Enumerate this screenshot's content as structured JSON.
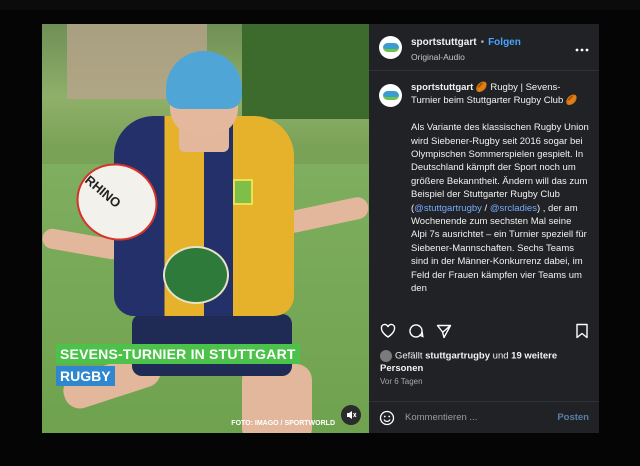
{
  "post": {
    "account": "sportstuttgart",
    "follow_label": "Folgen",
    "audio": "Original-Audio",
    "separator": "•",
    "caption_username": "sportstuttgart",
    "caption_title": "🏉 Rugby | Sevens-Turnier beim Stuttgarter Rugby Club 🏉",
    "caption_body_1": "Als Variante des klassischen Rugby Union wird Siebener-Rugby seit 2016 sogar bei Olympischen Sommerspielen gespielt. In Deutschland kämpft der Sport noch um größere Bekanntheit. Ändern will das zum Beispiel der Stuttgarter Rugby Club (",
    "mention_1": "@stuttgartrugby",
    "caption_body_2": " / ",
    "mention_2": "@srcladies",
    "caption_body_3": ") , der am Wochenende zum sechsten Mal seine Alpi 7s ausrichtet – ein Turnier speziell für Siebener-Mannschaften. Sechs Teams sind in der Männer-Konkurrenz dabei, im Feld der Frauen kämpfen vier Teams um den",
    "likes_prefix": "Gefällt ",
    "likes_user": "stuttgartrugby",
    "likes_mid": " und ",
    "likes_count": "19 weitere Personen",
    "date": "Vor 6 Tagen",
    "comment_placeholder": "Kommentieren ...",
    "post_button": "Posten"
  },
  "image": {
    "caption_line1": "SEVENS-TURNIER IN STUTTGART",
    "caption_line2": "RUGBY",
    "credit": "FOTO: IMAGO / SPORTWORLD",
    "ball_text": "RHINO"
  },
  "icons": {
    "more": "more-options-icon",
    "heart": "heart-icon",
    "comment": "comment-icon",
    "share": "share-icon",
    "bookmark": "bookmark-icon",
    "emoji": "emoji-icon",
    "mute": "mute-icon"
  },
  "colors": {
    "follow": "#4aa3ff",
    "mention": "#78a9ff",
    "caption_green": "#4cc24a",
    "caption_blue": "#2f87cf",
    "panel_bg": "#202225"
  }
}
